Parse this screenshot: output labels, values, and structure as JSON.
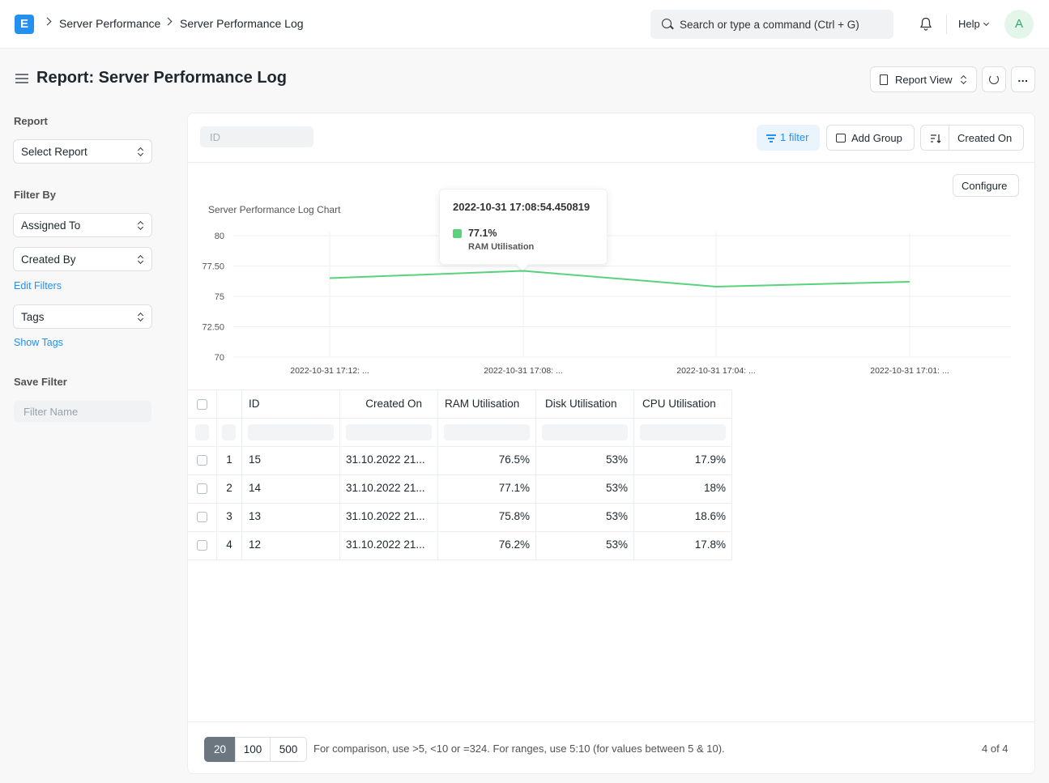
{
  "navbar": {
    "logo": "E",
    "breadcrumbs": [
      "Server Performance",
      "Server Performance Log"
    ],
    "search_placeholder": "Search or type a command (Ctrl + G)",
    "help_label": "Help",
    "avatar_initial": "A"
  },
  "header": {
    "title": "Report: Server Performance Log",
    "report_view_label": "Report View",
    "more_label": "..."
  },
  "sidebar": {
    "report_label": "Report",
    "select_report": "Select Report",
    "filter_by_label": "Filter By",
    "assigned_to": "Assigned To",
    "created_by": "Created By",
    "edit_filters": "Edit Filters",
    "tags": "Tags",
    "show_tags": "Show Tags",
    "save_filter_label": "Save Filter",
    "filter_name_placeholder": "Filter Name"
  },
  "toolbar": {
    "id_placeholder": "ID",
    "filter_label": "1 filter",
    "add_group_label": "Add Group",
    "sort_field": "Created On",
    "configure_label": "Configure"
  },
  "tooltip": {
    "title": "2022-10-31 17:08:54.450819",
    "value": "77.1%",
    "label": "RAM Utilisation"
  },
  "chart_data": {
    "type": "line",
    "title": "Server Performance Log Chart",
    "categories": [
      "2022-10-31 17:12: ...",
      "2022-10-31 17:08: ...",
      "2022-10-31 17:04: ...",
      "2022-10-31 17:01: ..."
    ],
    "series": [
      {
        "name": "RAM Utilisation",
        "values": [
          76.5,
          77.1,
          75.8,
          76.2
        ]
      }
    ],
    "yticks": [
      "80",
      "77.50",
      "75",
      "72.50",
      "70"
    ],
    "ylim": [
      70,
      80
    ],
    "grid": true,
    "color": "#59d37b"
  },
  "table": {
    "columns": [
      "ID",
      "Created On",
      "RAM Utilisation",
      "Disk Utilisation",
      "CPU Utilisation"
    ],
    "rows": [
      {
        "n": "1",
        "id": "15",
        "created_on": "31.10.2022 21...",
        "ram": "76.5%",
        "disk": "53%",
        "cpu": "17.9%"
      },
      {
        "n": "2",
        "id": "14",
        "created_on": "31.10.2022 21...",
        "ram": "77.1%",
        "disk": "53%",
        "cpu": "18%"
      },
      {
        "n": "3",
        "id": "13",
        "created_on": "31.10.2022 21...",
        "ram": "75.8%",
        "disk": "53%",
        "cpu": "18.6%"
      },
      {
        "n": "4",
        "id": "12",
        "created_on": "31.10.2022 21...",
        "ram": "76.2%",
        "disk": "53%",
        "cpu": "17.8%"
      }
    ]
  },
  "footer": {
    "page_sizes": [
      "20",
      "100",
      "500"
    ],
    "hint": "For comparison, use >5, <10 or =324. For ranges, use 5:10 (for values between 5 & 10).",
    "count": "4 of 4"
  }
}
